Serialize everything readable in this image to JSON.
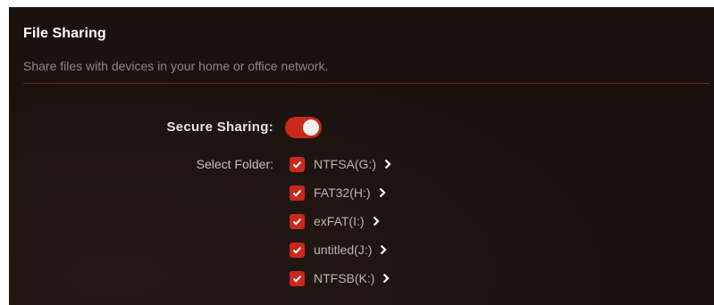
{
  "panel": {
    "title": "File Sharing",
    "description": "Share files with devices in your home or office network."
  },
  "secure_sharing": {
    "label": "Secure Sharing:",
    "enabled": true
  },
  "select_folder": {
    "label": "Select Folder:",
    "folders": [
      {
        "name": "NTFSA(G:)",
        "checked": true
      },
      {
        "name": "FAT32(H:)",
        "checked": true
      },
      {
        "name": "exFAT(I:)",
        "checked": true
      },
      {
        "name": "untitled(J:)",
        "checked": true
      },
      {
        "name": "NTFSB(K:)",
        "checked": true
      }
    ]
  },
  "colors": {
    "accent": "#c9281b",
    "background": "#1b1210",
    "divider": "#7a1e16"
  },
  "icons": {
    "checkbox": "check-icon",
    "expand": "chevron-right-icon"
  }
}
